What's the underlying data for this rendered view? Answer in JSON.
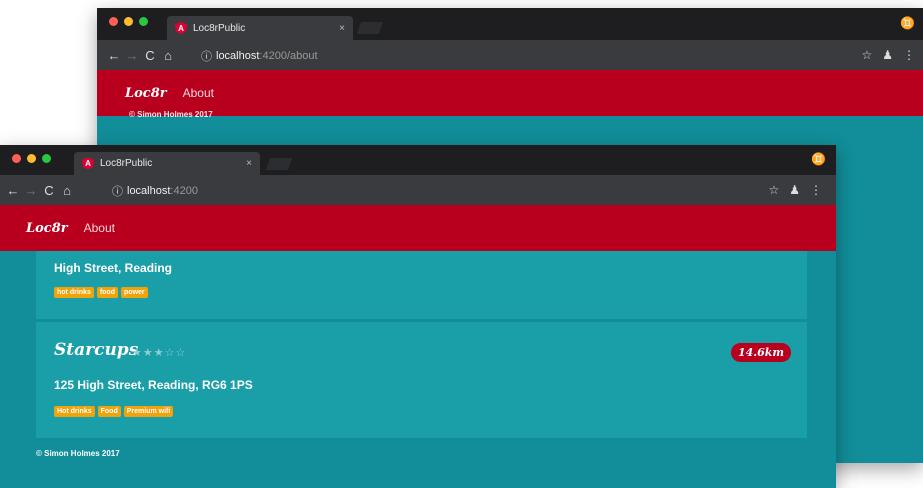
{
  "back_window": {
    "tab_title": "Loc8rPublic",
    "url_host": "localhost",
    "url_path": ":4200/about",
    "brand": "Loc8r",
    "nav_about": "About",
    "partial_footer": "© Simon Holmes 2017"
  },
  "front_window": {
    "tab_title": "Loc8rPublic",
    "url_host": "localhost",
    "url_path": ":4200",
    "brand": "Loc8r",
    "nav_about": "About",
    "locations": [
      {
        "address": "High Street, Reading",
        "facilities": [
          "hot drinks",
          "food",
          "power"
        ]
      },
      {
        "name": "Starcups",
        "rating": 3,
        "stars": "★★★☆☆",
        "distance": "14.6km",
        "address": "125 High Street, Reading, RG6 1PS",
        "facilities": [
          "Hot drinks",
          "Food",
          "Premium wifi"
        ]
      }
    ],
    "footer": "© Simon Holmes 2017"
  },
  "icons": {
    "back": "←",
    "forward": "→",
    "reload": "C",
    "home": "⌂",
    "info": "ⓘ",
    "star": "☆",
    "extension": "♟",
    "menu": "⋮",
    "close": "×",
    "incognito": "♊"
  },
  "colors": {
    "appbar": "#b8001e",
    "content": "#118e99",
    "card": "#1a9ea8",
    "tag": "#f0a30a"
  }
}
